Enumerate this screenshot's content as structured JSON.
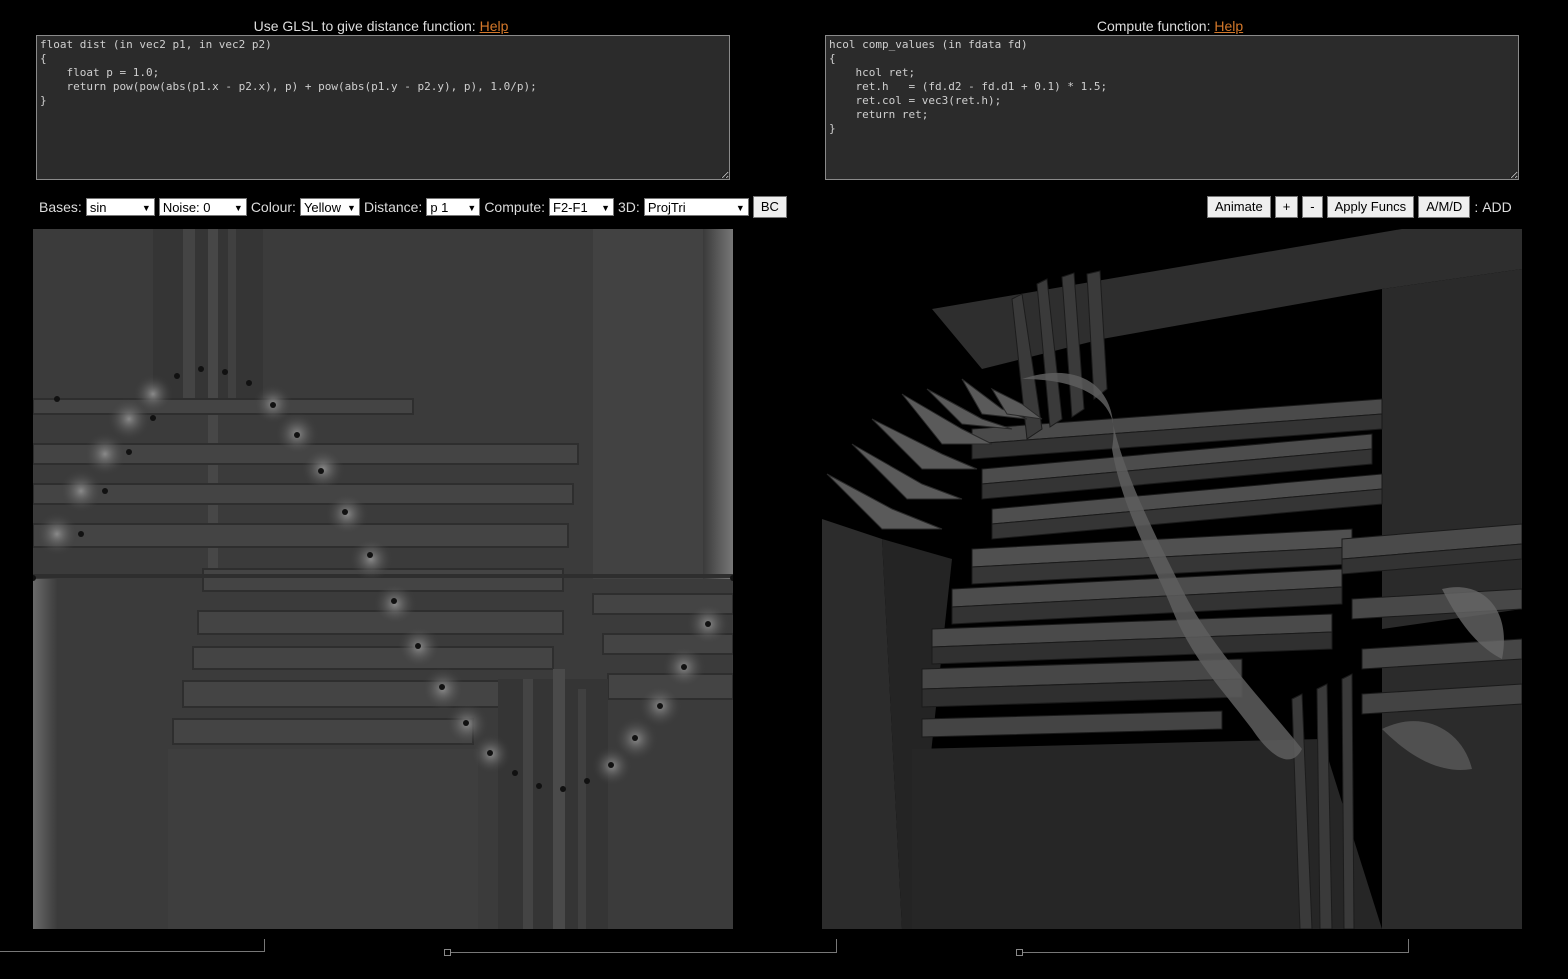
{
  "left_panel": {
    "title": "Use GLSL to give distance function:",
    "help": "Help",
    "code": "float dist (in vec2 p1, in vec2 p2)\n{\n    float p = 1.0;\n    return pow(pow(abs(p1.x - p2.x), p) + pow(abs(p1.y - p2.y), p), 1.0/p);\n}"
  },
  "right_panel": {
    "title": "Compute function:",
    "help": "Help",
    "code": "hcol comp_values (in fdata fd)\n{\n    hcol ret;\n    ret.h   = (fd.d2 - fd.d1 + 0.1) * 1.5;\n    ret.col = vec3(ret.h);\n    return ret;\n}"
  },
  "toolbar": {
    "bases_label": "Bases:",
    "bases_value": "sin",
    "noise_value": "Noise: 0",
    "colour_label": "Colour:",
    "colour_value": "Yellow",
    "distance_label": "Distance:",
    "distance_value": "p 1",
    "compute_label": "Compute:",
    "compute_value": "F2-F1",
    "threed_label": "3D:",
    "threed_value": "ProjTri",
    "bc": "BC",
    "animate": "Animate",
    "plus": "+",
    "minus": "-",
    "apply_funcs": "Apply Funcs",
    "amd": "A/M/D",
    "colon": ":",
    "mode": "ADD"
  }
}
